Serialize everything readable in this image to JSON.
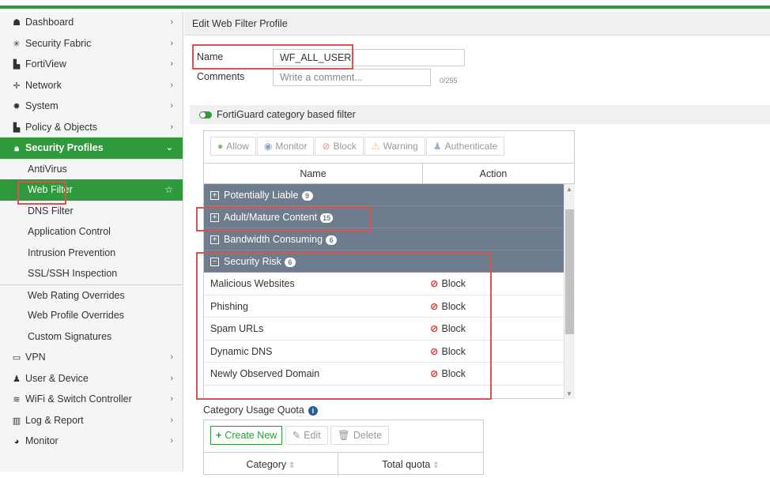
{
  "sidebar": {
    "items": [
      {
        "label": "Dashboard",
        "icon": "dashboard-icon",
        "glyph": "☗"
      },
      {
        "label": "Security Fabric",
        "icon": "fabric-icon",
        "glyph": "✳"
      },
      {
        "label": "FortiView",
        "icon": "fortiview-icon",
        "glyph": "▙"
      },
      {
        "label": "Network",
        "icon": "network-icon",
        "glyph": "✛"
      },
      {
        "label": "System",
        "icon": "system-gear-icon",
        "glyph": "✹"
      },
      {
        "label": "Policy & Objects",
        "icon": "policy-icon",
        "glyph": "▙"
      },
      {
        "label": "Security Profiles",
        "icon": "lock-icon",
        "glyph": "🔒"
      }
    ],
    "subitems": [
      "AntiVirus",
      "Web Filter",
      "DNS Filter",
      "Application Control",
      "Intrusion Prevention",
      "SSL/SSH Inspection",
      "Web Rating Overrides",
      "Web Profile Overrides",
      "Custom Signatures"
    ],
    "bottom_items": [
      {
        "label": "VPN",
        "icon": "vpn-monitor-icon",
        "glyph": "▭"
      },
      {
        "label": "User & Device",
        "icon": "user-icon",
        "glyph": "♟"
      },
      {
        "label": "WiFi & Switch Controller",
        "icon": "wifi-icon",
        "glyph": "≋"
      },
      {
        "label": "Log & Report",
        "icon": "report-chart-icon",
        "glyph": "▥"
      },
      {
        "label": "Monitor",
        "icon": "monitor-icon",
        "glyph": "◕"
      }
    ],
    "active_color": "#2e9a3c"
  },
  "page": {
    "title": "Edit Web Filter Profile",
    "name_label": "Name",
    "name_value": "WF_ALL_USER",
    "comments_label": "Comments",
    "comments_placeholder": "Write a comment...",
    "char_count": "0/255",
    "fortiguard_label": "FortiGuard category based filter"
  },
  "toolbar": {
    "allow": "Allow",
    "monitor": "Monitor",
    "block": "Block",
    "warning": "Warning",
    "authenticate": "Authenticate"
  },
  "table": {
    "col_name": "Name",
    "col_action": "Action",
    "groups": [
      {
        "label": "Potentially Liable",
        "count": "9",
        "expanded": false
      },
      {
        "label": "Adult/Mature Content",
        "count": "15",
        "expanded": false
      },
      {
        "label": "Bandwidth Consuming",
        "count": "6",
        "expanded": false
      },
      {
        "label": "Security Risk",
        "count": "6",
        "expanded": true
      }
    ],
    "rows": [
      {
        "name": "Malicious Websites",
        "action": "Block"
      },
      {
        "name": "Phishing",
        "action": "Block"
      },
      {
        "name": "Spam URLs",
        "action": "Block"
      },
      {
        "name": "Dynamic DNS",
        "action": "Block"
      },
      {
        "name": "Newly Observed Domain",
        "action": "Block"
      }
    ]
  },
  "quota": {
    "title": "Category Usage Quota",
    "create_new": "Create New",
    "edit": "Edit",
    "delete": "Delete",
    "col_category": "Category",
    "col_total": "Total quota"
  },
  "colors": {
    "accent": "#2e9a3c",
    "group_row": "#6d7d8d",
    "block": "#d9302c",
    "highlight_box": "#d9534f"
  }
}
